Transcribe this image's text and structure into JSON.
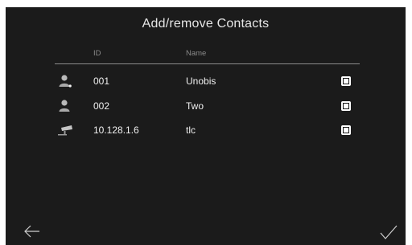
{
  "header": {
    "title": "Add/remove Contacts"
  },
  "table": {
    "columns": {
      "id": "ID",
      "name": "Name"
    },
    "rows": [
      {
        "icon": "user-icon",
        "id": "001",
        "name": "Unobis",
        "checked": false
      },
      {
        "icon": "user-icon",
        "id": "002",
        "name": "Two",
        "checked": false
      },
      {
        "icon": "camera-icon",
        "id": "10.128.1.6",
        "name": "tlc",
        "checked": false
      }
    ]
  },
  "footer": {
    "back_icon": "arrow-left-icon",
    "confirm_icon": "checkmark-icon"
  },
  "colors": {
    "background": "#1b1b1b",
    "text": "#f0f0f0",
    "header_text": "#8a8a8a",
    "divider": "#8c8c8c"
  }
}
